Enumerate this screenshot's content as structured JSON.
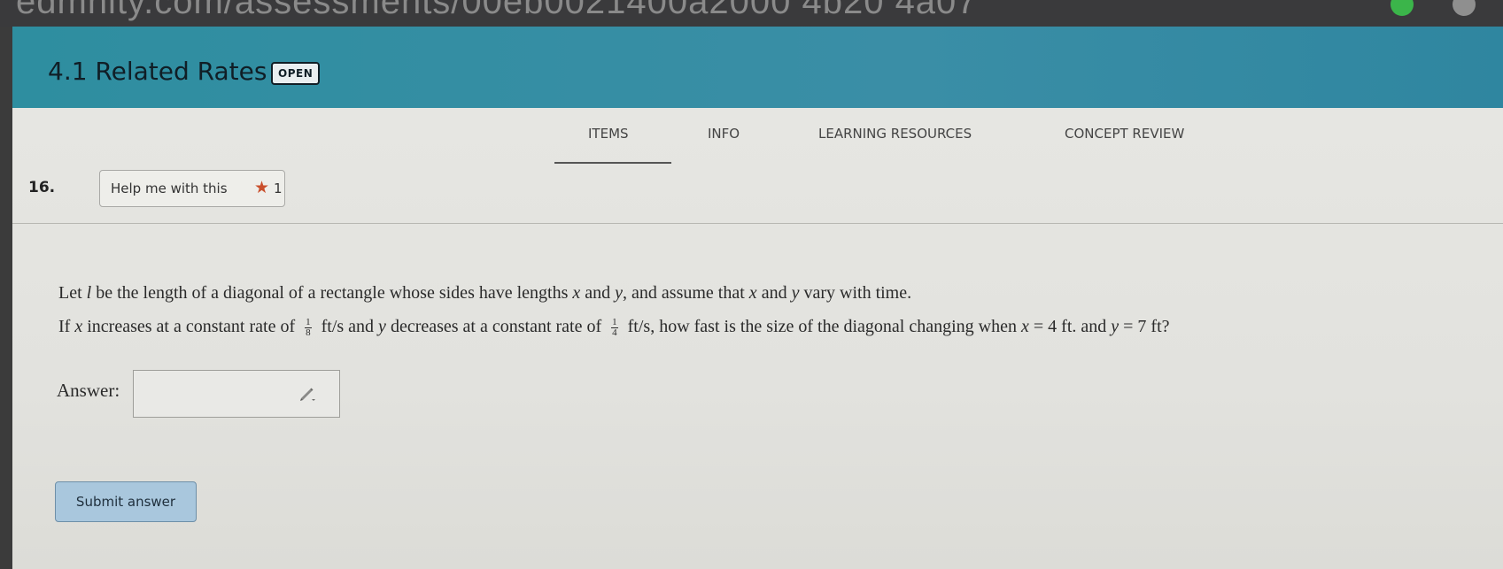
{
  "browser": {
    "url_fragment": "edmnity.com/assessments/00eb0021400a2000 4b20 4a07"
  },
  "header": {
    "title": "4.1 Related Rates",
    "status_badge": "OPEN"
  },
  "tabs": [
    {
      "label": "ITEMS",
      "active": true
    },
    {
      "label": "INFO",
      "active": false
    },
    {
      "label": "LEARNING RESOURCES",
      "active": false
    },
    {
      "label": "CONCEPT REVIEW",
      "active": false
    }
  ],
  "question": {
    "number": "16.",
    "help_button_label": "Help me with this",
    "help_count": "1",
    "line1": {
      "t1": "Let",
      "v_l": "l",
      "t2": "be the length of a diagonal of a rectangle whose sides have lengths",
      "v_x": "x",
      "t3": "and",
      "v_y": "y",
      "t4": ", and assume that",
      "v_x2": "x",
      "t5": "and",
      "v_y2": "y",
      "t6": "vary with time."
    },
    "line2": {
      "t1": "If",
      "v_x": "x",
      "t2": "increases at a constant rate of",
      "frac1_num": "1",
      "frac1_den": "8",
      "t3": "ft/s and",
      "v_y": "y",
      "t4": "decreases at a constant rate of",
      "frac2_num": "1",
      "frac2_den": "4",
      "t5": "ft/s, how fast is the size of the diagonal changing when",
      "v_x2": "x",
      "t6": "= 4  ft. and",
      "v_y2": "y",
      "t7": "= 7  ft?"
    },
    "answer_label": "Answer:",
    "answer_value": "",
    "submit_label": "Submit answer"
  },
  "colors": {
    "header_bg": "#3a8ea6",
    "content_bg": "#e4e4e0",
    "submit_bg": "#a9c7dd",
    "star": "#c94f2c"
  },
  "icons": {
    "help_star": "star-icon",
    "answer_edit": "pencil-icon"
  }
}
